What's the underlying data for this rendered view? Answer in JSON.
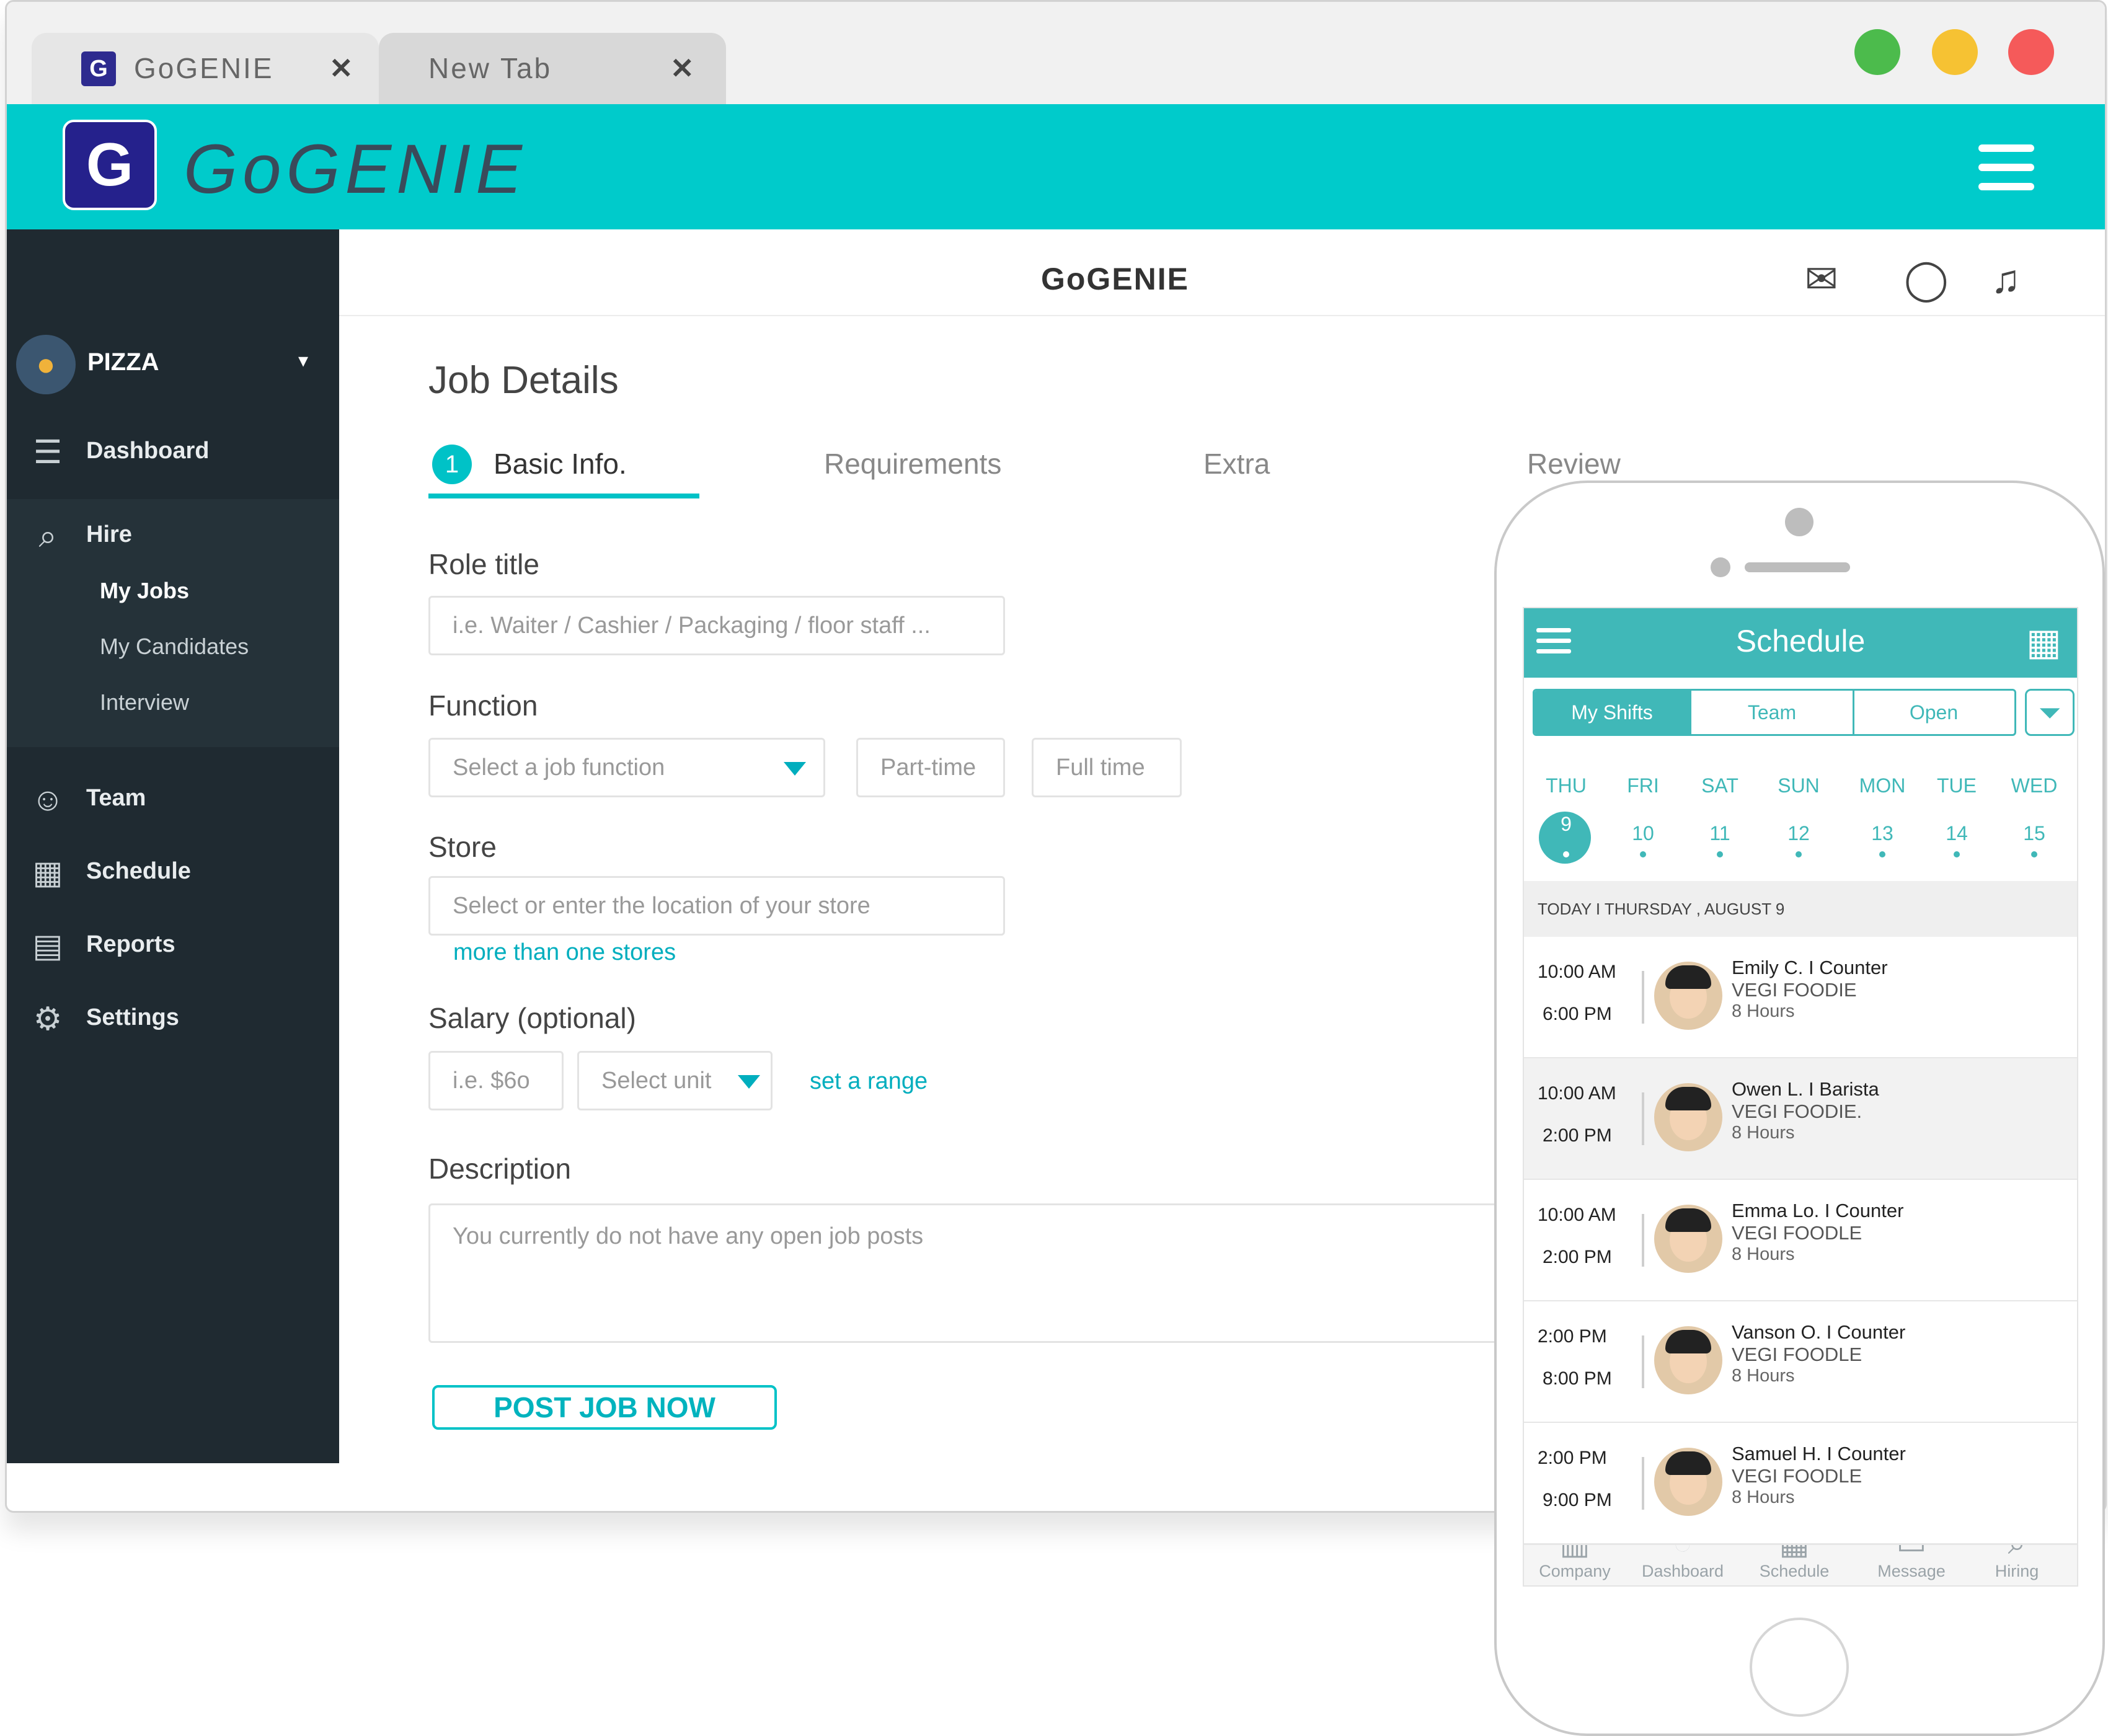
{
  "browser": {
    "tabs": [
      {
        "title": "GoGENIE",
        "close": "✕",
        "favicon": "G"
      },
      {
        "title": "New Tab",
        "close": "✕"
      }
    ],
    "window_controls": {
      "green": "#4cbb4c",
      "yellow": "#f6c233",
      "red": "#f55a5a"
    }
  },
  "app": {
    "logo_letter": "G",
    "logo_text": "GoGENIE",
    "accent": "#00cbcb",
    "menu_icon": "hamburger-icon"
  },
  "sidebar": {
    "store": {
      "name": "PIZZA",
      "icon": "pizza-pin-icon"
    },
    "items": [
      {
        "label": "Dashboard",
        "icon": "dashboard-icon"
      },
      {
        "label": "Hire",
        "icon": "search-person-icon"
      },
      {
        "label": "Team",
        "icon": "team-icon"
      },
      {
        "label": "Schedule",
        "icon": "calendar-icon"
      },
      {
        "label": "Reports",
        "icon": "reports-icon"
      },
      {
        "label": "Settings",
        "icon": "gear-icon"
      }
    ],
    "hire_sub": [
      {
        "label": "My Jobs",
        "active": true
      },
      {
        "label": "My Candidates",
        "active": false
      },
      {
        "label": "Interview",
        "active": false
      }
    ]
  },
  "topbar": {
    "title": "GoGENIE",
    "icons": [
      "mail-icon",
      "chat-icon",
      "bell-icon"
    ]
  },
  "form": {
    "page_title": "Job Details",
    "steps": [
      {
        "num": "1",
        "label": "Basic Info."
      },
      {
        "label": "Requirements"
      },
      {
        "label": "Extra"
      },
      {
        "label": "Review"
      }
    ],
    "role_title": {
      "label": "Role title",
      "placeholder": "i.e. Waiter / Cashier / Packaging / floor staff ..."
    },
    "function": {
      "label": "Function",
      "select_placeholder": "Select a job function",
      "options": [
        "Part-time",
        "Full time"
      ]
    },
    "store": {
      "label": "Store",
      "placeholder": "Select or enter the location of your store",
      "more_link": "more than one stores"
    },
    "salary": {
      "label": "Salary (optional)",
      "amount_placeholder": "i.e. $6o",
      "unit_placeholder": "Select unit",
      "range_link": "set a range"
    },
    "description": {
      "label": "Description",
      "placeholder": "You currently do not have any open job posts"
    },
    "submit": "POST JOB  NOW"
  },
  "phone": {
    "title": "Schedule",
    "segments": [
      "My Shifts",
      "Team",
      "Open"
    ],
    "days": [
      {
        "dow": "THU",
        "num": "9",
        "selected": true
      },
      {
        "dow": "FRI",
        "num": "10"
      },
      {
        "dow": "SAT",
        "num": "11"
      },
      {
        "dow": "SUN",
        "num": "12"
      },
      {
        "dow": "MON",
        "num": "13"
      },
      {
        "dow": "TUE",
        "num": "14"
      },
      {
        "dow": "WED",
        "num": "15"
      }
    ],
    "today_label": "TODAY  I  THURSDAY , AUGUST 9",
    "shifts": [
      {
        "start": "10:00 AM",
        "end": "6:00 PM",
        "name": "Emily C.   I  Counter",
        "store": "VEGI FOODIE",
        "hours": "8 Hours"
      },
      {
        "start": "10:00 AM",
        "end": "2:00 PM",
        "name": "Owen L.   I  Barista",
        "store": "VEGI FOODIE.",
        "hours": "8 Hours"
      },
      {
        "start": "10:00 AM",
        "end": "2:00 PM",
        "name": "Emma Lo.   I  Counter",
        "store": "VEGI FOODLE",
        "hours": "8 Hours"
      },
      {
        "start": "2:00 PM",
        "end": "8:00 PM",
        "name": "Vanson O.   I  Counter",
        "store": "VEGI FOODLE",
        "hours": "8 Hours"
      },
      {
        "start": "2:00 PM",
        "end": "9:00 PM",
        "name": "Samuel H.   I  Counter",
        "store": "VEGI FOODLE",
        "hours": "8 Hours"
      }
    ],
    "nav": [
      {
        "label": "Company",
        "icon": "building-icon"
      },
      {
        "label": "Dashboard",
        "icon": "gauge-icon"
      },
      {
        "label": "Schedule",
        "icon": "calendar-icon"
      },
      {
        "label": "Message",
        "icon": "message-icon"
      },
      {
        "label": "Hiring",
        "icon": "search-icon"
      }
    ]
  }
}
